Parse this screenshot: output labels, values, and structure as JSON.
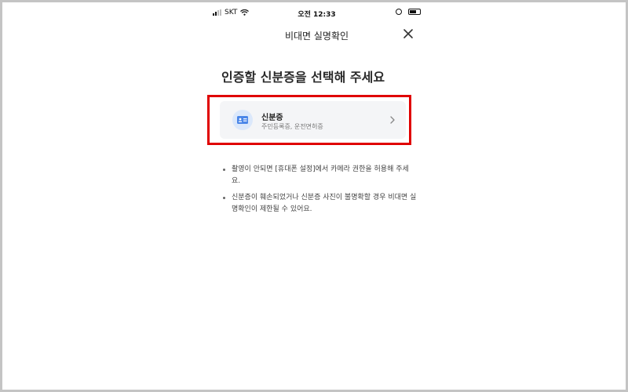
{
  "status_bar": {
    "carrier": "SKT",
    "time": "오전 12:33"
  },
  "header": {
    "title": "비대면 실명확인"
  },
  "main": {
    "title": "인증할 신분증을 선택해 주세요",
    "id_card_option": {
      "title": "신분증",
      "subtitle": "주민등록증, 운전면허증",
      "icon": "id-card-icon"
    },
    "notes": [
      "촬영이 안되면 [휴대폰 설정]에서 카메라 권한을 허용해 주세요.",
      "신분증이 훼손되었거나 신분증 사진이 불명확할 경우 비대면 실명확인이 제한될 수 있어요."
    ]
  },
  "colors": {
    "highlight": "#e00000",
    "card_bg": "#f4f5f7",
    "icon_bg": "#dbe8fb",
    "icon_accent": "#4a86e8"
  }
}
